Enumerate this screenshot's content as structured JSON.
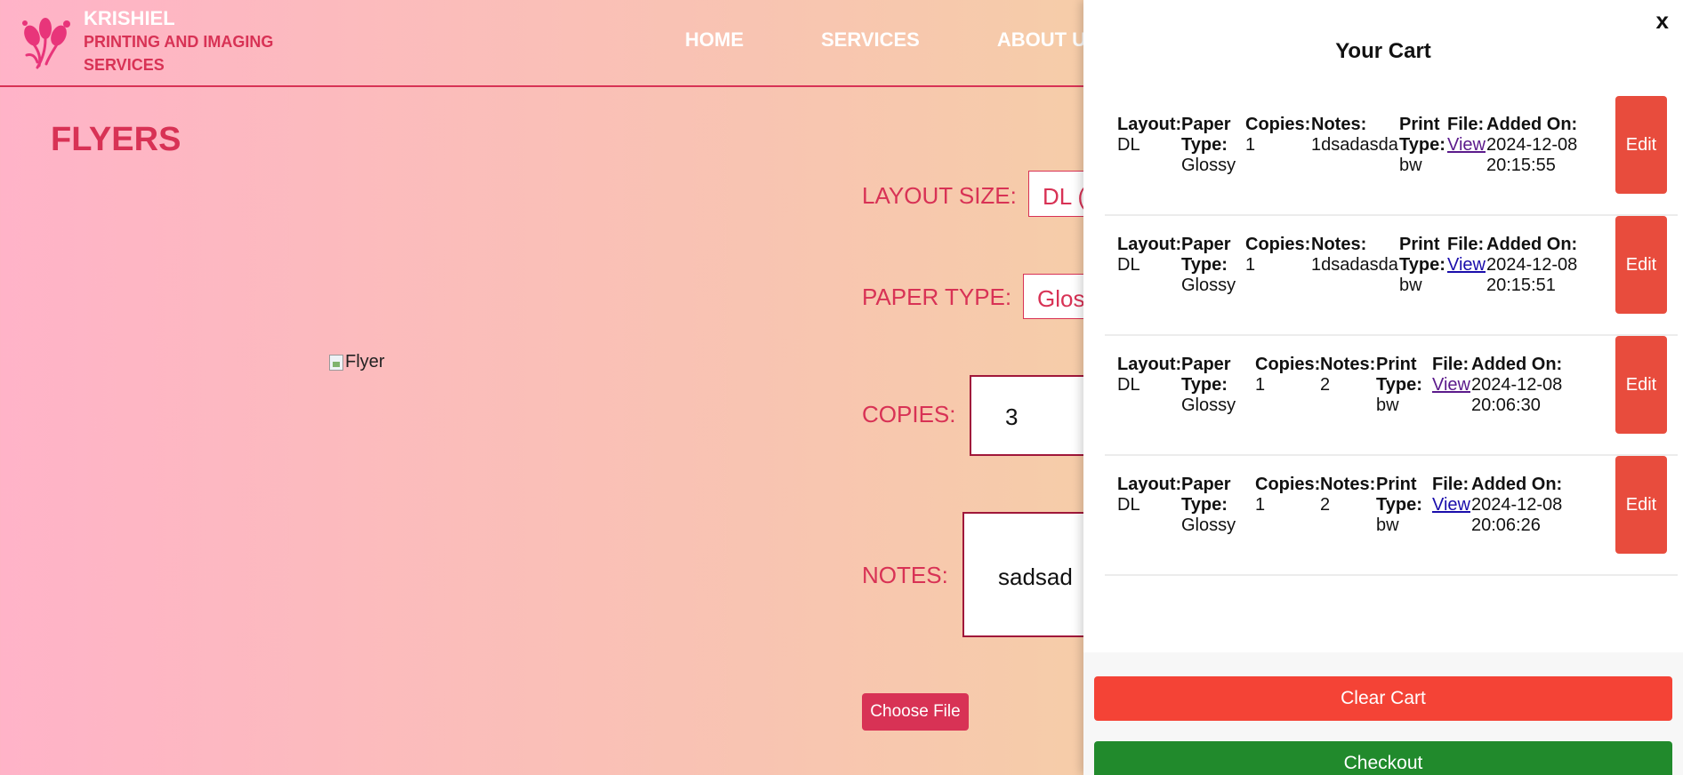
{
  "header": {
    "brand_name": "KRISHIEL",
    "brand_sub_1": "PRINTING AND IMAGING",
    "brand_sub_2": "SERVICES",
    "nav": [
      "HOME",
      "SERVICES",
      "ABOUT U"
    ]
  },
  "main": {
    "title": "FLYERS",
    "preview_alt": "Flyer",
    "layout_label": "LAYOUT SIZE:",
    "layout_value": "DL (",
    "paper_label": "PAPER TYPE:",
    "paper_value": "Glos",
    "copies_label": "COPIES:",
    "copies_value": "3",
    "notes_label": "NOTES:",
    "notes_value": "sadsad",
    "choose_file": "Choose File"
  },
  "cart": {
    "close": "x",
    "title": "Your Cart",
    "items": [
      {
        "layout_k": "Layout:",
        "layout_v": "DL",
        "paper_k1": "Paper",
        "paper_k2": "Type:",
        "paper_v": "Glossy",
        "copies_k": "Copies:",
        "copies_v": "1",
        "notes_k": "Notes:",
        "notes_v": "1dsadasda",
        "print_k1": "Print",
        "print_k2": "Type:",
        "print_v": "bw",
        "file_k": "File:",
        "file_v": "View",
        "added_k": "Added On:",
        "added_date": "2024-12-08",
        "added_time": "20:15:55",
        "edit": "Edit"
      },
      {
        "layout_k": "Layout:",
        "layout_v": "DL",
        "paper_k1": "Paper",
        "paper_k2": "Type:",
        "paper_v": "Glossy",
        "copies_k": "Copies:",
        "copies_v": "1",
        "notes_k": "Notes:",
        "notes_v": "1dsadasda",
        "print_k1": "Print",
        "print_k2": "Type:",
        "print_v": "bw",
        "file_k": "File:",
        "file_v": "View",
        "added_k": "Added On:",
        "added_date": "2024-12-08",
        "added_time": "20:15:51",
        "edit": "Edit"
      },
      {
        "layout_k": "Layout:",
        "layout_v": "DL",
        "paper_k1": "Paper",
        "paper_k2": "Type:",
        "paper_v": "Glossy",
        "copies_k": "Copies:",
        "copies_v": "1",
        "notes_k": "Notes:",
        "notes_v": "2",
        "print_k1": "Print",
        "print_k2": "Type:",
        "print_v": "bw",
        "file_k": "File:",
        "file_v": "View",
        "added_k": "Added On:",
        "added_date": "2024-12-08",
        "added_time": "20:06:30",
        "edit": "Edit"
      },
      {
        "layout_k": "Layout:",
        "layout_v": "DL",
        "paper_k1": "Paper",
        "paper_k2": "Type:",
        "paper_v": "Glossy",
        "copies_k": "Copies:",
        "copies_v": "1",
        "notes_k": "Notes:",
        "notes_v": "2",
        "print_k1": "Print",
        "print_k2": "Type:",
        "print_v": "bw",
        "file_k": "File:",
        "file_v": "View",
        "added_k": "Added On:",
        "added_date": "2024-12-08",
        "added_time": "20:06:26",
        "edit": "Edit"
      }
    ],
    "clear_label": "Clear Cart",
    "checkout_label": "Checkout"
  },
  "colors": {
    "brand": "#d83255",
    "edit": "#e84c3d",
    "clear": "#f44336",
    "checkout": "#218a2c"
  },
  "icons": {
    "logo": "flower-logo-icon",
    "broken_image": "broken-image-icon"
  }
}
